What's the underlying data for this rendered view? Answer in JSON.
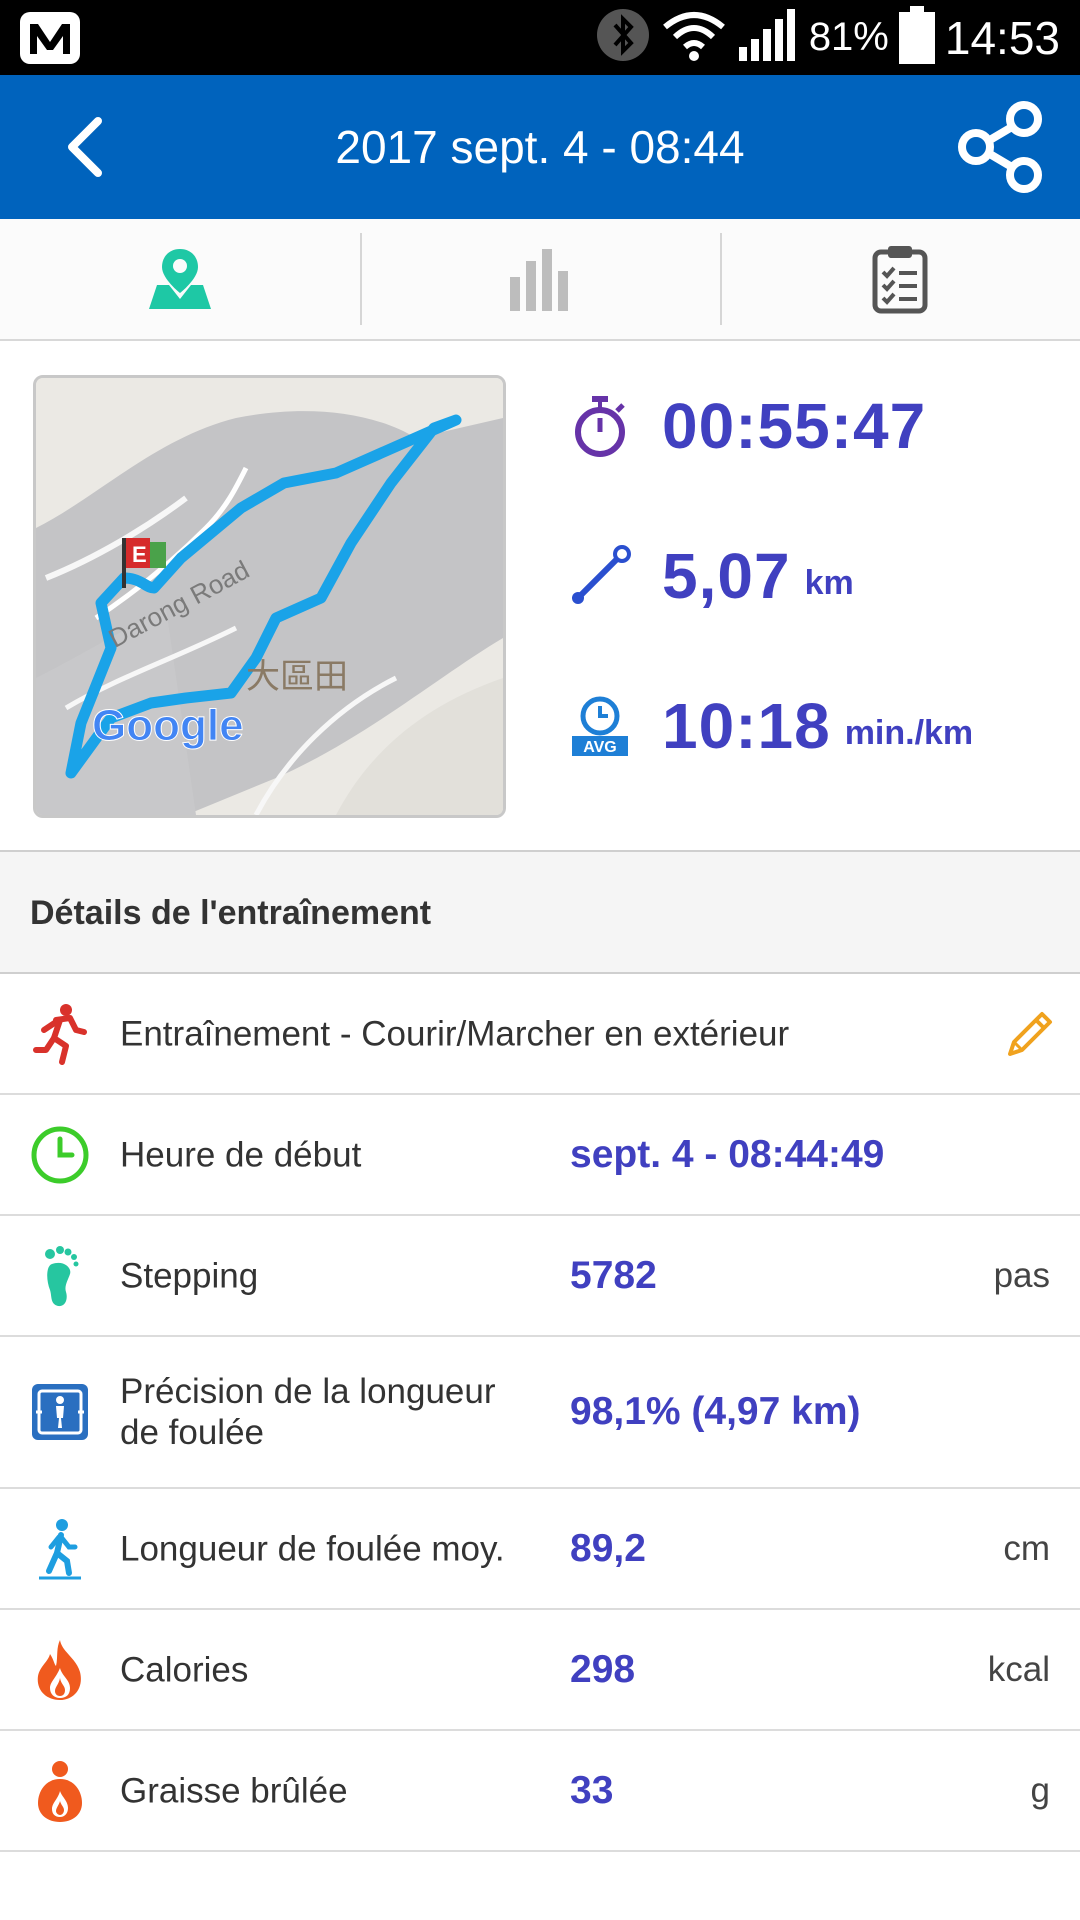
{
  "status_bar": {
    "battery_percent": "81%",
    "time": "14:53",
    "icons": [
      "app-m-icon",
      "bluetooth-icon",
      "wifi-icon",
      "signal-icon",
      "battery-icon"
    ]
  },
  "app_bar": {
    "title": "2017 sept. 4 - 08:44",
    "color": "#0063bd",
    "back_icon": "chevron-left-icon",
    "share_icon": "share-icon"
  },
  "tabs": [
    {
      "icon": "map-pin-icon",
      "active": true,
      "color": "#1ec8a5"
    },
    {
      "icon": "bar-chart-icon",
      "active": false
    },
    {
      "icon": "clipboard-list-icon",
      "active": false
    }
  ],
  "map": {
    "labels": [
      "Darong Road",
      "大區田",
      "E",
      "Google"
    ],
    "route_color": "#1aa3e8"
  },
  "summary": {
    "duration": {
      "icon": "stopwatch-icon",
      "value": "00:55:47"
    },
    "distance": {
      "icon": "distance-icon",
      "value": "5,07",
      "unit": "km"
    },
    "pace": {
      "icon": "avg-pace-icon",
      "icon_text": "AVG",
      "value": "10:18",
      "unit": "min./km"
    }
  },
  "details": {
    "header": "Détails de l'entraînement",
    "workout": {
      "icon": "running-icon",
      "label": "Entraînement - Courir/Marcher en extérieur",
      "edit_icon": "pencil-icon"
    },
    "rows": [
      {
        "icon": "clock-icon",
        "label": "Heure de début",
        "value": "sept. 4 - 08:44:49",
        "unit": ""
      },
      {
        "icon": "footprint-icon",
        "label": "Stepping",
        "value": "5782",
        "unit": "pas"
      },
      {
        "icon": "stride-accuracy-icon",
        "label": "Précision de la longueur de foulée",
        "value": "98,1% (4,97 km)",
        "unit": ""
      },
      {
        "icon": "walking-icon",
        "label": "Longueur de foulée moy.",
        "value": "89,2",
        "unit": "cm"
      },
      {
        "icon": "flame-icon",
        "label": "Calories",
        "value": "298",
        "unit": "kcal"
      },
      {
        "icon": "fat-burn-icon",
        "label": "Graisse brûlée",
        "value": "33",
        "unit": "g"
      }
    ]
  },
  "colors": {
    "accent_value": "#4040c0",
    "text": "#333333",
    "divider": "#dcdcdc"
  }
}
